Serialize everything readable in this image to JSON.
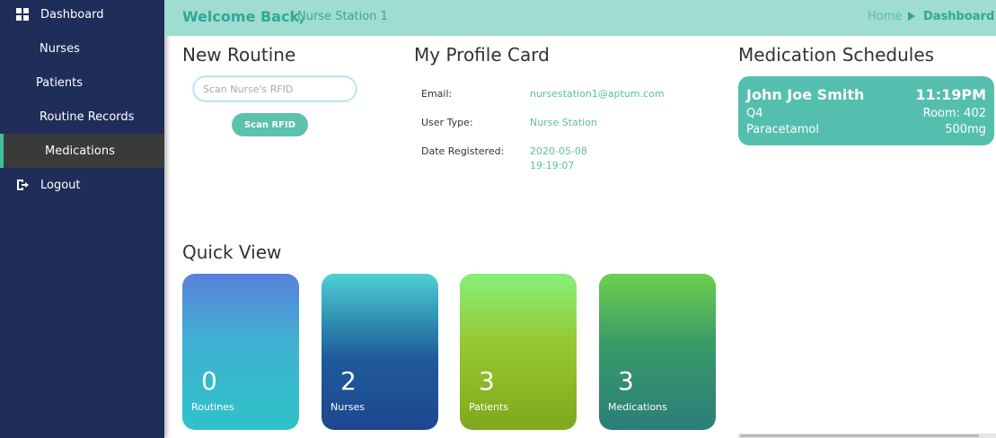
{
  "sidebar": {
    "items": [
      {
        "label": "Dashboard",
        "icon": "grid-icon"
      },
      {
        "label": "Nurses"
      },
      {
        "label": "Patients"
      },
      {
        "label": "Routine Records"
      },
      {
        "label": "Medications",
        "active": true
      },
      {
        "label": "Logout",
        "icon": "logout-icon"
      }
    ]
  },
  "header": {
    "welcome": "Welcome Back,",
    "station": "Nurse Station 1",
    "breadcrumb": {
      "home": "Home",
      "current": "Dashboard"
    }
  },
  "new_routine": {
    "title": "New Routine",
    "input_placeholder": "Scan Nurse's RFID",
    "button_label": "Scan RFID"
  },
  "profile": {
    "title": "My Profile Card",
    "email_label": "Email:",
    "email_value": "nursestation1@aptum.com",
    "usertype_label": "User Type:",
    "usertype_value": "Nurse Station",
    "registered_label": "Date Registered:",
    "registered_date": "2020-05-08",
    "registered_time": "19:19:07"
  },
  "medication_schedules": {
    "title": "Medication Schedules",
    "items": [
      {
        "patient": "John Joe Smith",
        "time": "11:19PM",
        "code": "Q4",
        "room": "Room: 402",
        "drug": "Paracetamol",
        "dose": "500mg"
      }
    ]
  },
  "quick_view": {
    "title": "Quick View",
    "cards": [
      {
        "value": "0",
        "label": "Routines"
      },
      {
        "value": "2",
        "label": "Nurses"
      },
      {
        "value": "3",
        "label": "Patients"
      },
      {
        "value": "3",
        "label": "Medications"
      }
    ]
  },
  "colors": {
    "sidebar": "#1f2d59",
    "header": "#9fdcd2",
    "accent": "#2fa897",
    "med_card": "#54bfae"
  }
}
